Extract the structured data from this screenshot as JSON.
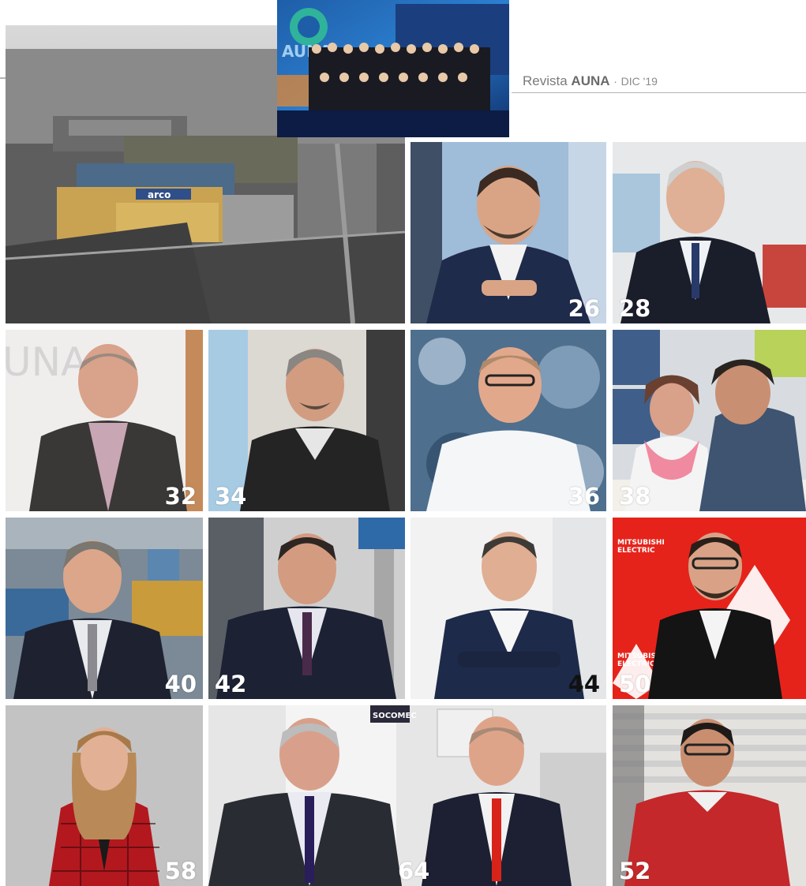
{
  "header": {
    "magazine_prefix": "Revista",
    "magazine_brand": "AUNA",
    "separator": "·",
    "issue_date": "DIC '19"
  },
  "factory_photo": {
    "sign_text": "arco"
  },
  "event_photo": {
    "sign_text": "AUNA"
  },
  "tiles": {
    "p26": "26",
    "p28": "28",
    "p32": "32",
    "p34": "34",
    "p36": "36",
    "p38": "38",
    "p40": "40",
    "p42": "42",
    "p44": "44",
    "p50": "50",
    "p58": "58",
    "p64": "64",
    "p52": "52"
  },
  "wall_texts": {
    "mitsubishi_1": "MITSUBISHI",
    "mitsubishi_2": "ELECTRIC",
    "socomec": "SOCOMEC",
    "auna_wall": "UNA"
  },
  "colors": {
    "mitsubishi_red": "#e5231b",
    "header_text": "#7a7a7a",
    "rule": "#b5b5b5"
  }
}
